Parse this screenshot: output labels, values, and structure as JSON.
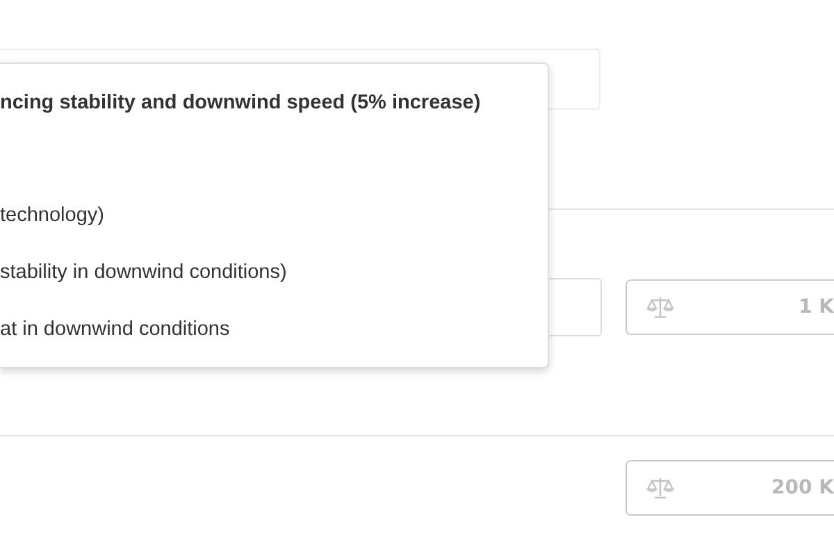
{
  "dropdown": {
    "options": [
      {
        "label": "ncing stability and downwind speed (5% increase)",
        "selected": true
      },
      {
        "label": "technology)",
        "selected": false
      },
      {
        "label": "stability in downwind conditions)",
        "selected": false
      },
      {
        "label": "at in downwind conditions",
        "selected": false
      }
    ]
  },
  "weight_fields": [
    {
      "value": "1 K"
    },
    {
      "value": "200 K"
    }
  ]
}
